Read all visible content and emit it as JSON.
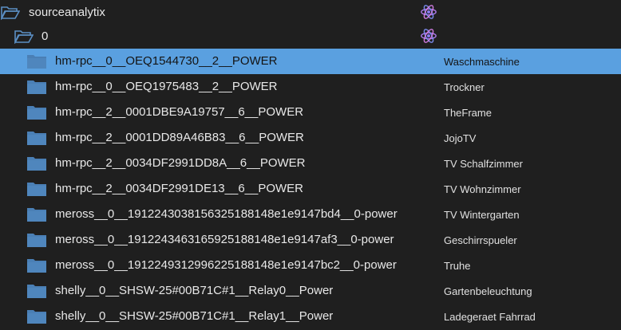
{
  "tree": {
    "root": {
      "label": "sourceanalytix",
      "icon": "open-folder-icon",
      "badge_icon": "atom-icon"
    },
    "child": {
      "label": "0",
      "icon": "open-folder-icon",
      "badge_icon": "atom-icon"
    },
    "items": [
      {
        "label": "hm-rpc__0__OEQ1544730__2__POWER",
        "desc": "Waschmaschine",
        "selected": true
      },
      {
        "label": "hm-rpc__0__OEQ1975483__2__POWER",
        "desc": "Trockner"
      },
      {
        "label": "hm-rpc__2__0001DBE9A19757__6__POWER",
        "desc": "TheFrame"
      },
      {
        "label": "hm-rpc__2__0001DD89A46B83__6__POWER",
        "desc": "JojoTV"
      },
      {
        "label": "hm-rpc__2__0034DF2991DD8A__6__POWER",
        "desc": "TV Schalfzimmer"
      },
      {
        "label": "hm-rpc__2__0034DF2991DE13__6__POWER",
        "desc": "TV Wohnzimmer"
      },
      {
        "label": "meross__0__1912243038156325188148e1e9147bd4__0-power",
        "desc": "TV Wintergarten"
      },
      {
        "label": "meross__0__1912243463165925188148e1e9147af3__0-power",
        "desc": "Geschirrspueler"
      },
      {
        "label": "meross__0__1912249312996225188148e1e9147bc2__0-power",
        "desc": "Truhe"
      },
      {
        "label": "shelly__0__SHSW-25#00B71C#1__Relay0__Power",
        "desc": "Gartenbeleuchtung"
      },
      {
        "label": "shelly__0__SHSW-25#00B71C#1__Relay1__Power",
        "desc": "Ladegeraet Fahrrad"
      }
    ]
  },
  "colors": {
    "background": "#1f1f1f",
    "selection": "#5aa0e0",
    "folder": "#4a7fb5",
    "text": "#e6e6e6"
  }
}
